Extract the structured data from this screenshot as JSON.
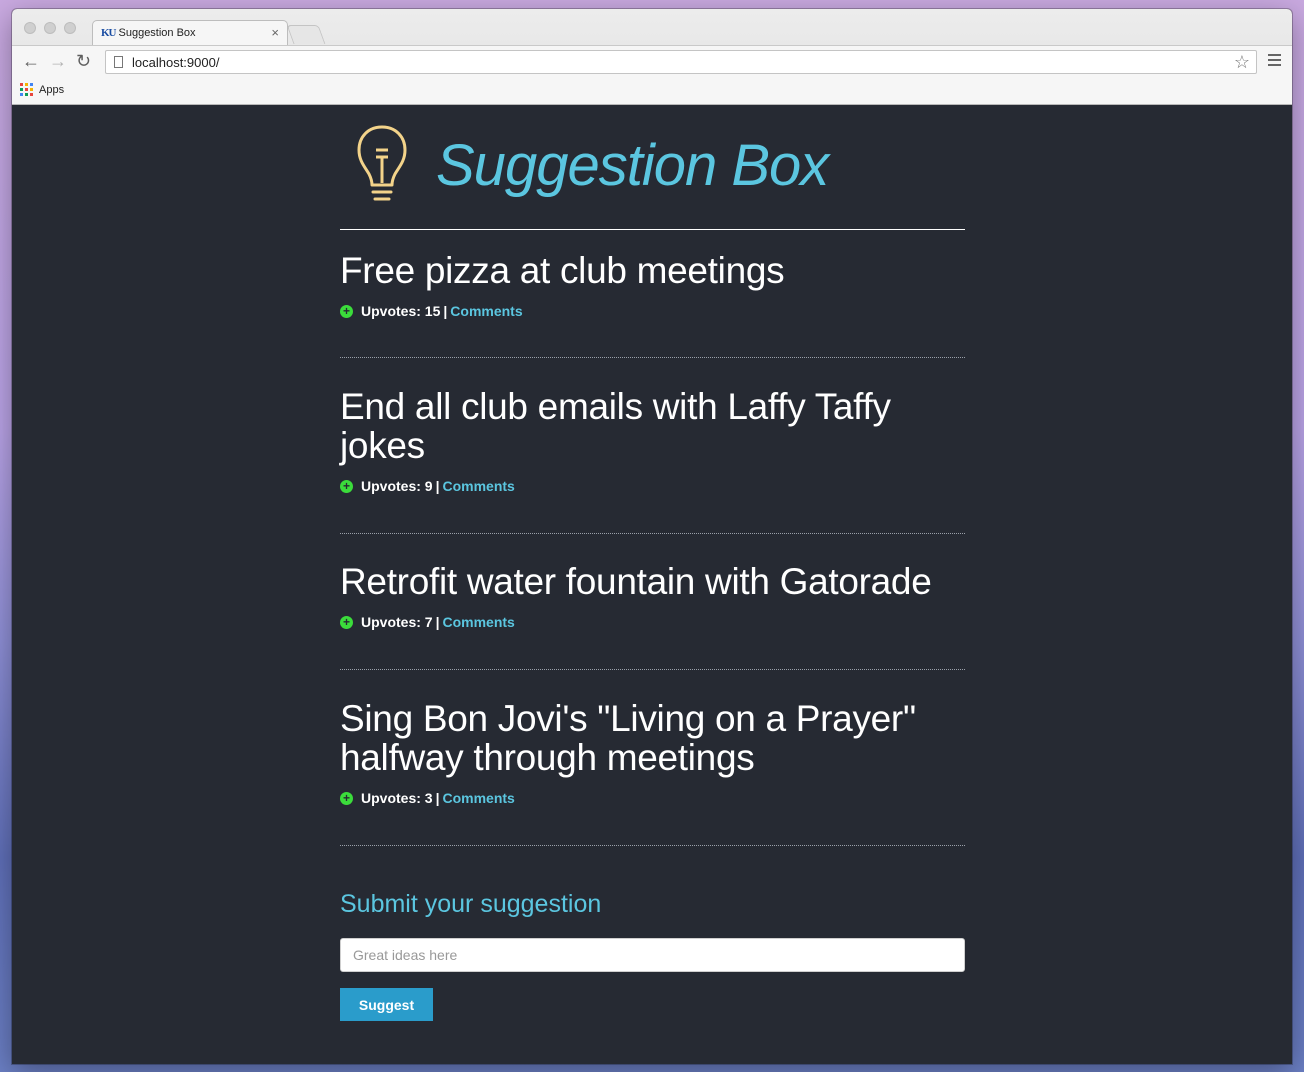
{
  "browser": {
    "tab": {
      "favicon_text": "KU",
      "title": "Suggestion Box",
      "close_glyph": "×"
    },
    "url": "localhost:9000/",
    "bookmarks": {
      "apps_label": "Apps"
    },
    "nav": {
      "back_glyph": "←",
      "forward_glyph": "→",
      "reload_glyph": "↻",
      "star_glyph": "☆"
    }
  },
  "site": {
    "title": "Suggestion Box",
    "accent_color": "#5bc6e0",
    "bulb_color": "#f3d38a",
    "upvote_color": "#3bdc3b",
    "button_color": "#2a9ccb"
  },
  "suggestions": [
    {
      "title": "Free pizza at club meetings",
      "upvotes_label": "Upvotes: 15",
      "separator": "|",
      "comments_label": "Comments"
    },
    {
      "title": "End all club emails with Laffy Taffy jokes",
      "upvotes_label": "Upvotes: 9",
      "separator": "|",
      "comments_label": "Comments"
    },
    {
      "title": "Retrofit water fountain with Gatorade",
      "upvotes_label": "Upvotes: 7",
      "separator": "|",
      "comments_label": "Comments"
    },
    {
      "title": "Sing Bon Jovi's \"Living on a Prayer\" halfway through meetings",
      "upvotes_label": "Upvotes: 3",
      "separator": "|",
      "comments_label": "Comments"
    }
  ],
  "form": {
    "heading": "Submit your suggestion",
    "input_placeholder": "Great ideas here",
    "input_value": "",
    "button_label": "Suggest"
  }
}
